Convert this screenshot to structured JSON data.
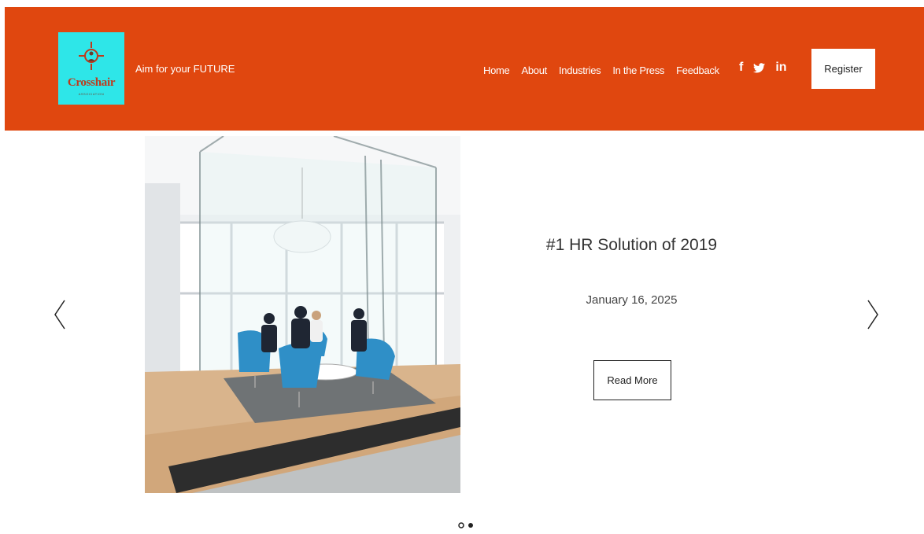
{
  "brand": {
    "logo_name": "Crosshair",
    "logo_tagline": "ASSOCIATION",
    "tagline": "Aim for your FUTURE",
    "logo_bg_color": "#2ee6e8",
    "logo_icon": "crosshair-icon"
  },
  "header": {
    "bg_color": "#e0470f",
    "nav": [
      {
        "label": "Home"
      },
      {
        "label": "About"
      },
      {
        "label": "Industries"
      },
      {
        "label": "In the Press"
      },
      {
        "label": "Feedback"
      }
    ],
    "social": [
      {
        "label": "f",
        "icon": "facebook-icon"
      },
      {
        "label": "",
        "icon": "twitter-icon"
      },
      {
        "label": "in",
        "icon": "linkedin-icon"
      }
    ],
    "register_label": "Register"
  },
  "slider": {
    "title": "#1 HR Solution of 2019",
    "date": "January 16, 2025",
    "read_more_label": "Read More",
    "prev_icon": "chevron-left-icon",
    "next_icon": "chevron-right-icon"
  }
}
